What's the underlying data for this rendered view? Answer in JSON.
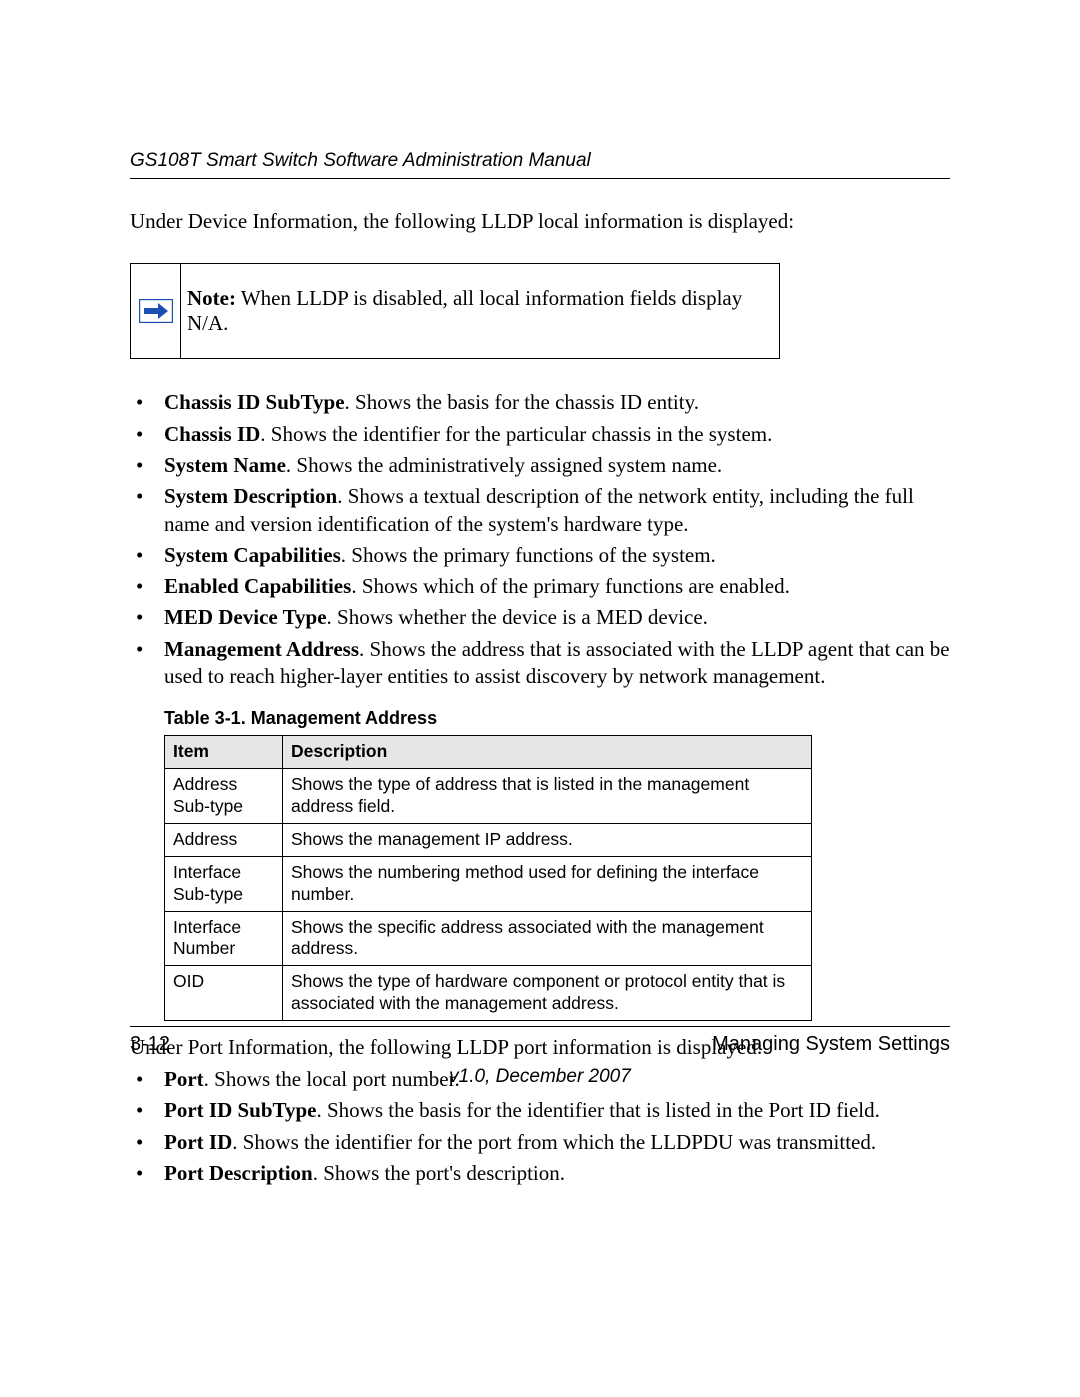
{
  "header": {
    "running_head": "GS108T Smart Switch Software Administration Manual"
  },
  "intro": "Under Device Information, the following LLDP local information is displayed:",
  "note": {
    "label": "Note:",
    "text": " When LLDP is disabled, all local information fields display N/A."
  },
  "device_info_bullets": [
    {
      "term": "Chassis ID SubType",
      "desc": ". Shows the basis for the chassis ID entity."
    },
    {
      "term": "Chassis ID",
      "desc": ". Shows the identifier for the particular chassis in the system."
    },
    {
      "term": "System Name",
      "desc": ". Shows the administratively assigned system name."
    },
    {
      "term": "System Description",
      "desc": ". Shows a textual description of the network entity, including the full name and version identification of the system's hardware type."
    },
    {
      "term": "System Capabilities",
      "desc": ". Shows the primary functions of the system."
    },
    {
      "term": "Enabled Capabilities",
      "desc": ". Shows which of the primary functions are enabled."
    },
    {
      "term": "MED Device Type",
      "desc": ". Shows whether the device is a MED device."
    },
    {
      "term": "Management Address",
      "desc": ". Shows the address that is associated with the LLDP agent that can be used to reach higher-layer entities to assist discovery by network management."
    }
  ],
  "table": {
    "caption": "Table 3-1. Management Address",
    "headers": {
      "item": "Item",
      "desc": "Description"
    },
    "rows": [
      {
        "item": "Address Sub-type",
        "desc": "Shows the type of address that is listed in the management address field."
      },
      {
        "item": "Address",
        "desc": "Shows the management IP address."
      },
      {
        "item": "Interface Sub-type",
        "desc": "Shows the numbering method used for defining the interface number."
      },
      {
        "item": "Interface Number",
        "desc": "Shows the specific address associated with the management address."
      },
      {
        "item": "OID",
        "desc": "Shows the type of hardware component or protocol entity that is associated with the management address."
      }
    ]
  },
  "under_port": "Under Port Information, the following LLDP port information is displayed:",
  "port_info_bullets": [
    {
      "term": "Port",
      "desc": ". Shows the local port number."
    },
    {
      "term": "Port ID SubType",
      "desc": ". Shows the basis for the identifier that is listed in the Port ID field."
    },
    {
      "term": "Port ID",
      "desc": ". Shows the identifier for the port from which the LLDPDU was transmitted."
    },
    {
      "term": "Port Description",
      "desc": ". Shows the port's description."
    }
  ],
  "footer": {
    "page_num": "3-12",
    "section": "Managing System Settings",
    "version": "v1.0, December 2007"
  }
}
